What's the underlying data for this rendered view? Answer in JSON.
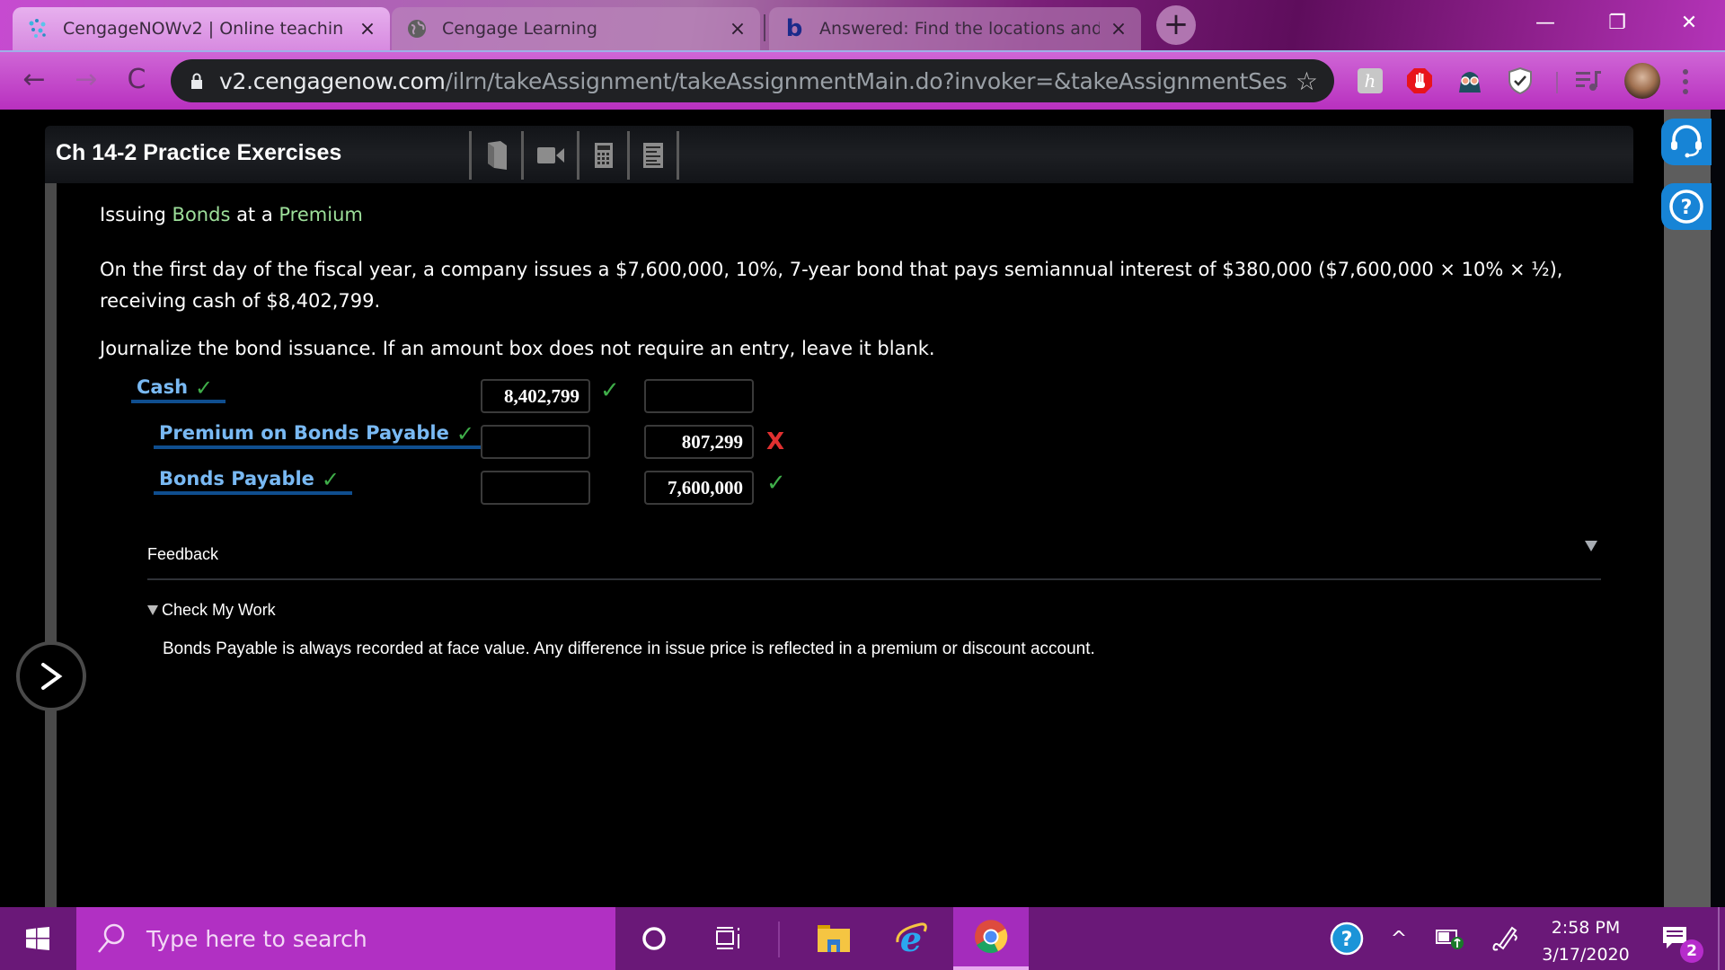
{
  "browser": {
    "tabs": [
      {
        "title": "CengageNOWv2 | Online teachin",
        "icon": "cengage-dots-icon",
        "active": true
      },
      {
        "title": "Cengage Learning",
        "icon": "globe-icon",
        "active": false
      },
      {
        "title": "Answered: Find the locations and",
        "icon": "bartleby-b-icon",
        "active": false
      }
    ],
    "close_glyph": "×",
    "new_tab_glyph": "+",
    "url_host": "v2.cengagenow.com",
    "url_path": "/ilrn/takeAssignment/takeAssignmentMain.do?invoker=&takeAssignmentSessionLoca...",
    "window_controls": {
      "minimize": "—",
      "restore": "❐",
      "close": "✕"
    },
    "nav": {
      "back": "←",
      "forward": "→",
      "reload": "C"
    },
    "star": "☆",
    "extensions": [
      "honey-extension-icon",
      "adblock-hand-icon",
      "darth-vader-extension-icon",
      "shield-check-extension-icon",
      "media-playlist-icon",
      "profile-avatar",
      "menu-dots-icon"
    ]
  },
  "assignment": {
    "header_title": "Ch 14-2 Practice Exercises",
    "tools": [
      "ebook-icon",
      "video-icon",
      "calculator-icon",
      "notes-icon"
    ],
    "problem_title": {
      "part1": "Issuing ",
      "part2": "Bonds",
      "part3": " at a ",
      "part4": "Premium"
    },
    "problem_body": "On the first day of the fiscal year, a company issues a $7,600,000, 10%, 7-year bond that pays semiannual interest of $380,000 ($7,600,000 × 10% × ½), receiving cash of $8,402,799.",
    "instructions": "Journalize the bond issuance. If an amount box does not require an entry, leave it blank.",
    "journal": [
      {
        "account": "Cash",
        "account_status": "correct",
        "debit": "8,402,799",
        "debit_status": "correct",
        "credit": "",
        "credit_status": ""
      },
      {
        "account": "Premium on Bonds Payable",
        "account_status": "correct",
        "debit": "",
        "debit_status": "",
        "credit": "807,299",
        "credit_status": "incorrect"
      },
      {
        "account": "Bonds Payable",
        "account_status": "correct",
        "debit": "",
        "debit_status": "",
        "credit": "7,600,000",
        "credit_status": "correct"
      }
    ],
    "check_glyph": "✓",
    "x_glyph": "X",
    "feedback_label": "Feedback",
    "check_my_work_label": "Check My Work",
    "check_my_work_text": "Bonds Payable is always recorded at face value. Any difference in issue price is reflected in a premium or discount account.",
    "next_glyph": ">",
    "colors": {
      "account_link": "#79b9f3",
      "highlight_green": "#9ddf9a",
      "correct": "#3fae49",
      "incorrect": "#e03030"
    }
  },
  "taskbar": {
    "search_placeholder": "Type here to search",
    "time": "2:58 PM",
    "date": "3/17/2020",
    "notification_count": "2",
    "tray_up": "^"
  }
}
